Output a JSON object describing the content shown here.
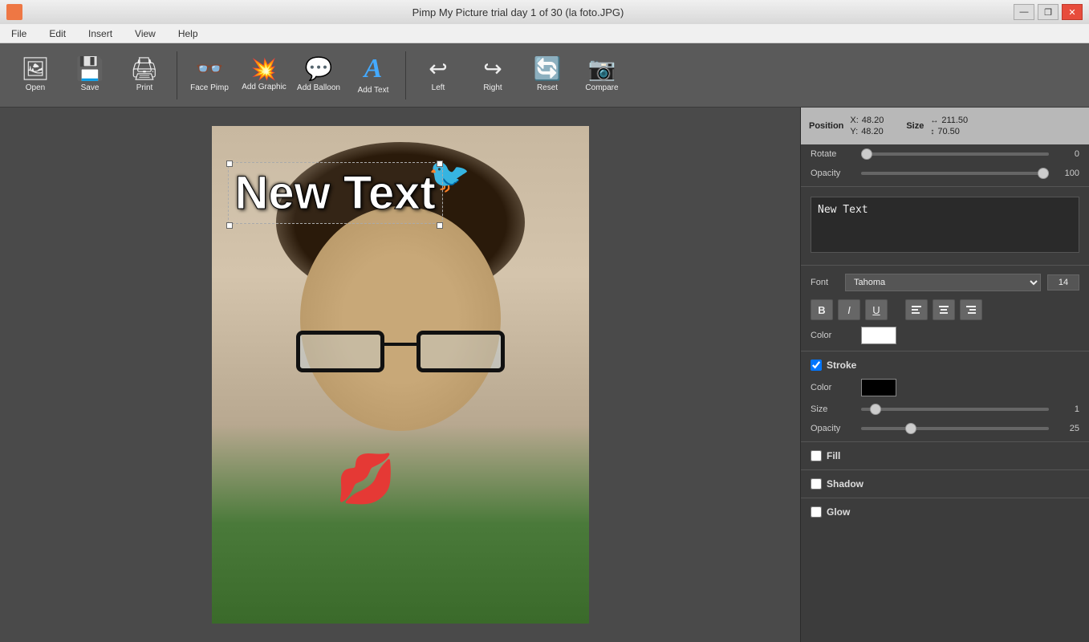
{
  "titlebar": {
    "title": "Pimp My Picture trial day 1 of 30 (la foto.JPG)",
    "minimize_label": "—",
    "restore_label": "❐",
    "close_label": "✕"
  },
  "menubar": {
    "items": [
      "File",
      "Edit",
      "Insert",
      "View",
      "Help"
    ]
  },
  "toolbar": {
    "buttons": [
      {
        "id": "open",
        "label": "Open",
        "icon": "🖼"
      },
      {
        "id": "save",
        "label": "Save",
        "icon": "💾"
      },
      {
        "id": "print",
        "label": "Print",
        "icon": "🖨"
      },
      {
        "id": "face-pimp",
        "label": "Face Pimp",
        "icon": "👓"
      },
      {
        "id": "add-graphic",
        "label": "Add Graphic",
        "icon": "💥"
      },
      {
        "id": "add-balloon",
        "label": "Add Balloon",
        "icon": "💬"
      },
      {
        "id": "add-text",
        "label": "Add Text",
        "icon": "A"
      },
      {
        "id": "left",
        "label": "Left",
        "icon": "↩"
      },
      {
        "id": "right",
        "label": "Right",
        "icon": "↪"
      },
      {
        "id": "reset",
        "label": "Reset",
        "icon": "🔄"
      },
      {
        "id": "compare",
        "label": "Compare",
        "icon": "📷"
      }
    ]
  },
  "position_bar": {
    "position_label": "Position",
    "x_label": "X:",
    "x_value": "48.20",
    "y_label": "Y:",
    "y_value": "48.20",
    "size_label": "Size",
    "w_value": "211.50",
    "h_value": "70.50"
  },
  "properties": {
    "rotate_label": "Rotate",
    "rotate_value": "0",
    "opacity_label": "Opacity",
    "opacity_value": "100",
    "text_content": "New Text",
    "font_label": "Font",
    "font_name": "Tahoma",
    "font_size": "14",
    "color_label": "Color",
    "text_color": "#ffffff",
    "stroke_section": "Stroke",
    "stroke_color": "#000000",
    "stroke_size_label": "Size",
    "stroke_size_value": "1",
    "stroke_opacity_label": "Opacity",
    "stroke_opacity_value": "25",
    "fill_label": "Fill",
    "shadow_label": "Shadow",
    "glow_label": "Glow"
  },
  "canvas": {
    "text": "New Text"
  },
  "format_buttons": {
    "bold": "B",
    "italic": "I",
    "underline": "U",
    "align_left": "≡",
    "align_center": "≡",
    "align_right": "≡"
  }
}
